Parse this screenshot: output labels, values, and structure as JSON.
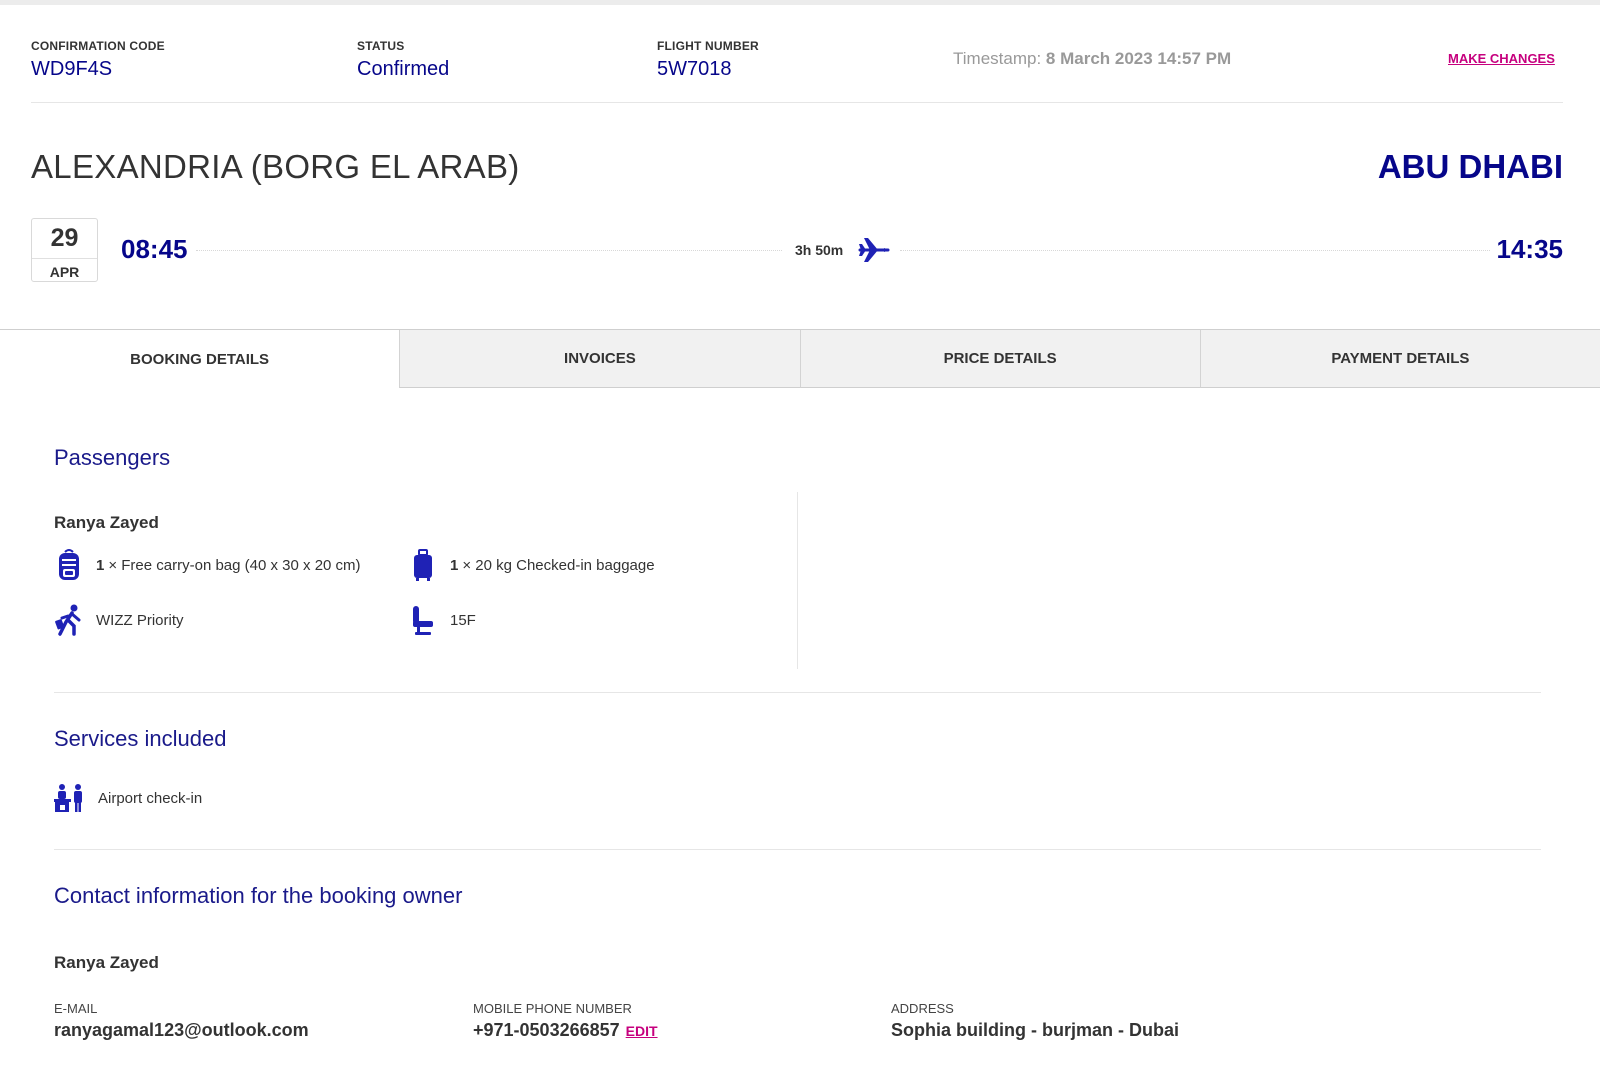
{
  "header": {
    "confirmation_label": "CONFIRMATION CODE",
    "confirmation_value": "WD9F4S",
    "status_label": "STATUS",
    "status_value": "Confirmed",
    "flight_label": "FLIGHT NUMBER",
    "flight_value": "5W7018",
    "timestamp_label": "Timestamp:",
    "timestamp_value": "8 March 2023 14:57 PM",
    "make_changes": "MAKE CHANGES"
  },
  "route": {
    "origin": "ALEXANDRIA (BORG EL ARAB)",
    "destination": "ABU DHABI",
    "date_day": "29",
    "date_month": "APR",
    "departure_time": "08:45",
    "arrival_time": "14:35",
    "duration": "3h 50m"
  },
  "tabs": [
    {
      "label": "BOOKING DETAILS",
      "active": true
    },
    {
      "label": "INVOICES",
      "active": false
    },
    {
      "label": "PRICE DETAILS",
      "active": false
    },
    {
      "label": "PAYMENT DETAILS",
      "active": false
    }
  ],
  "passengers": {
    "title": "Passengers",
    "name": "Ranya Zayed",
    "carry_on": {
      "qty": "1",
      "text": "× Free carry-on bag (40 x 30 x 20 cm)",
      "icon": "backpack-icon"
    },
    "checked": {
      "qty": "1",
      "text": "× 20 kg Checked-in baggage",
      "icon": "suitcase-icon"
    },
    "priority": {
      "text": "WIZZ Priority",
      "icon": "priority-walker-icon"
    },
    "seat": {
      "text": "15F",
      "icon": "seat-icon"
    }
  },
  "services": {
    "title": "Services included",
    "items": [
      {
        "text": "Airport check-in",
        "icon": "checkin-desk-icon"
      }
    ]
  },
  "contact": {
    "title": "Contact information for the booking owner",
    "name": "Ranya Zayed",
    "email_label": "E-MAIL",
    "email_value": "ranyagamal123@outlook.com",
    "phone_label": "MOBILE PHONE NUMBER",
    "phone_value": "+971-0503266857",
    "edit_label": "EDIT",
    "address_label": "ADDRESS",
    "address_value": "Sophia building - burjman - Dubai"
  },
  "colors": {
    "brand_navy": "#06068a",
    "heading_blue": "#1a1a8a",
    "accent_magenta": "#c6007e"
  }
}
